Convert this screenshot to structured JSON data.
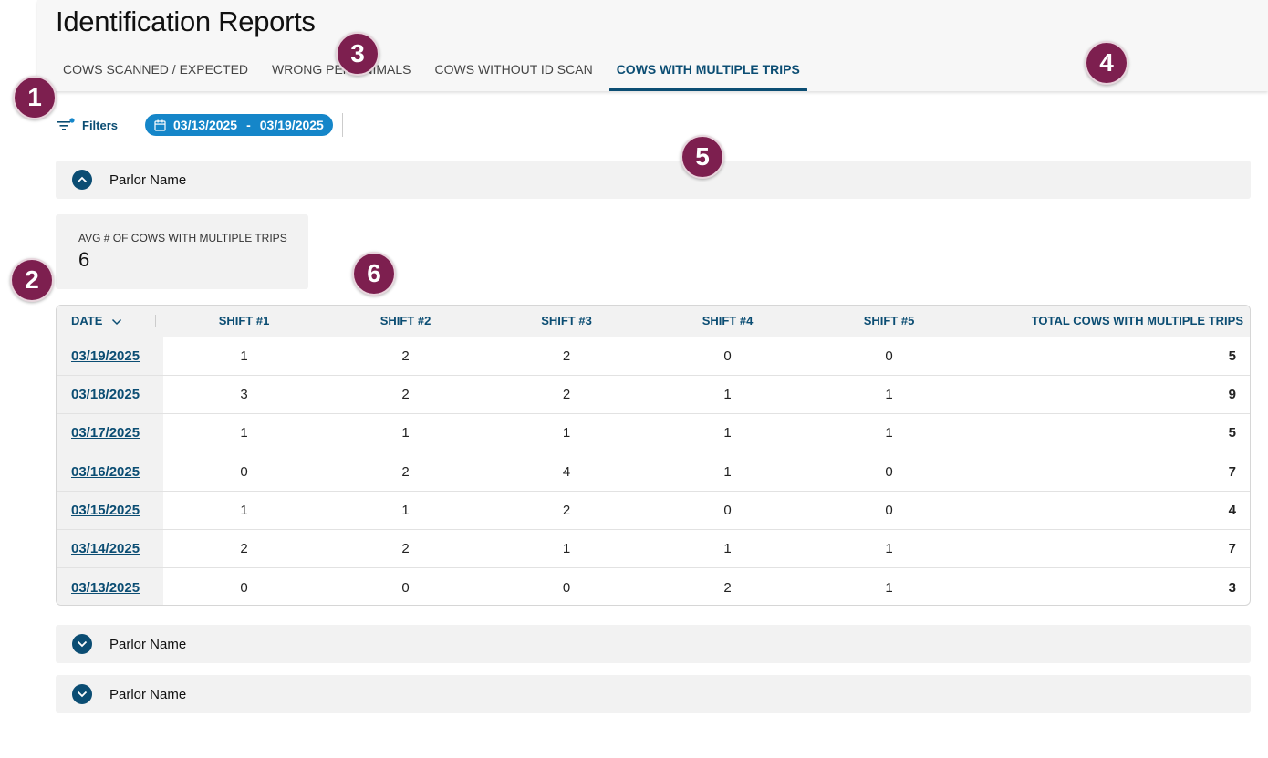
{
  "page": {
    "title": "Identification Reports"
  },
  "tabs": [
    {
      "label": "COWS SCANNED / EXPECTED",
      "active": false
    },
    {
      "label": "WRONG PEN ANIMALS",
      "active": false
    },
    {
      "label": "COWS WITHOUT ID SCAN",
      "active": false
    },
    {
      "label": "COWS WITH MULTIPLE TRIPS",
      "active": true
    }
  ],
  "filters": {
    "label": "Filters",
    "date_start": "03/13/2025",
    "date_separator": "-",
    "date_end": "03/19/2025"
  },
  "sections": [
    {
      "name": "Parlor Name",
      "expanded": true
    },
    {
      "name": "Parlor Name",
      "expanded": false
    },
    {
      "name": "Parlor Name",
      "expanded": false
    }
  ],
  "stat": {
    "label": "AVG # OF COWS WITH MULTIPLE TRIPS",
    "value": "6"
  },
  "table": {
    "columns": [
      "DATE",
      "SHIFT #1",
      "SHIFT #2",
      "SHIFT #3",
      "SHIFT #4",
      "SHIFT #5",
      "TOTAL COWS WITH MULTIPLE TRIPS"
    ],
    "rows": [
      {
        "date": "03/19/2025",
        "shifts": [
          "1",
          "2",
          "2",
          "0",
          "0"
        ],
        "total": "5"
      },
      {
        "date": "03/18/2025",
        "shifts": [
          "3",
          "2",
          "2",
          "1",
          "1"
        ],
        "total": "9"
      },
      {
        "date": "03/17/2025",
        "shifts": [
          "1",
          "1",
          "1",
          "1",
          "1"
        ],
        "total": "5"
      },
      {
        "date": "03/16/2025",
        "shifts": [
          "0",
          "2",
          "4",
          "1",
          "0"
        ],
        "total": "7"
      },
      {
        "date": "03/15/2025",
        "shifts": [
          "1",
          "1",
          "2",
          "0",
          "0"
        ],
        "total": "4"
      },
      {
        "date": "03/14/2025",
        "shifts": [
          "2",
          "2",
          "1",
          "1",
          "1"
        ],
        "total": "7"
      },
      {
        "date": "03/13/2025",
        "shifts": [
          "0",
          "0",
          "0",
          "2",
          "1"
        ],
        "total": "3"
      }
    ]
  },
  "markers": [
    "1",
    "2",
    "3",
    "4",
    "5",
    "6"
  ],
  "colors": {
    "accent": "#0b4d73",
    "pill": "#1586c9",
    "marker": "#7d1f4f",
    "panel": "#f2f2f2"
  }
}
